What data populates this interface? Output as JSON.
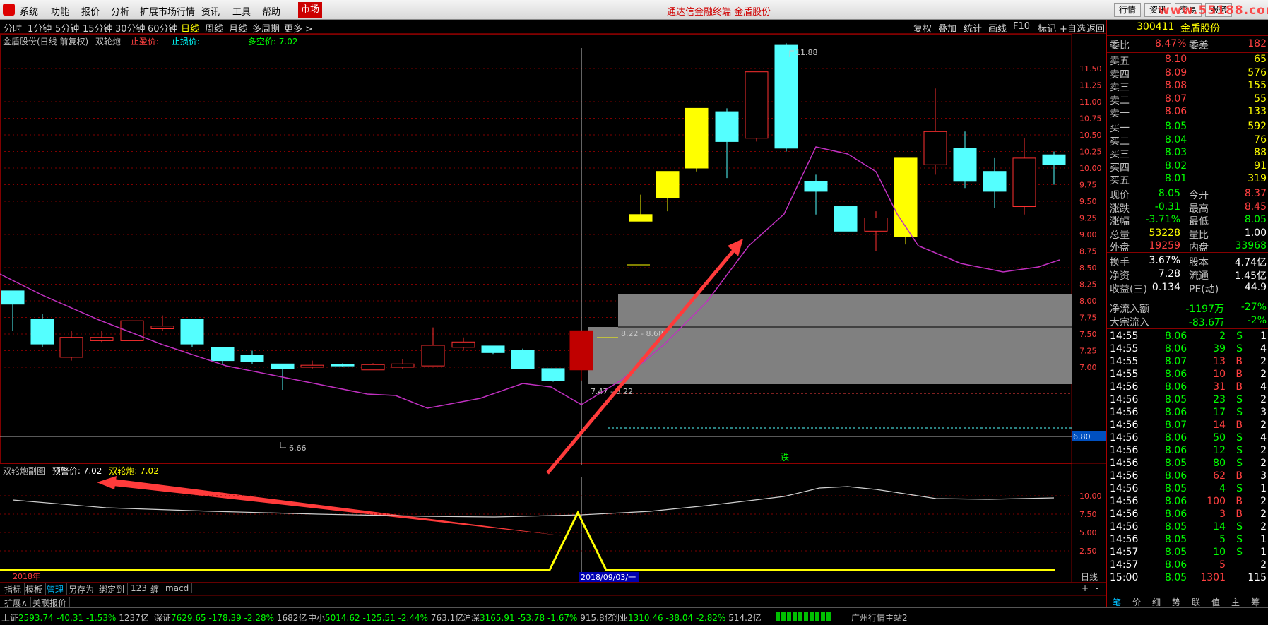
{
  "menu": [
    "系统",
    "功能",
    "报价",
    "分析",
    "扩展市场行情",
    "资讯",
    "工具",
    "帮助"
  ],
  "market_label": "市场",
  "window_title": "通达信金融终端 金盾股份",
  "top_right": [
    "行情",
    "资讯",
    "交易",
    "服务"
  ],
  "watermark": "www.55188.com",
  "periods": [
    "分时",
    "1分钟",
    "5分钟",
    "15分钟",
    "30分钟",
    "60分钟",
    "日线",
    "周线",
    "月线",
    "多周期",
    "更多 >"
  ],
  "active_period": "日线",
  "right_tools": [
    "复权",
    "叠加",
    "统计",
    "画线",
    "F10",
    "标记",
    "+自选",
    "返回"
  ],
  "chart_title": {
    "name": "金盾股份(日线 前复权)",
    "indicator": "双轮炮",
    "stop_profit": "止盈价: -",
    "stop_loss": "止损价: -",
    "duokong": "多空价: 7.02"
  },
  "sub_title": {
    "name": "双轮炮副图",
    "warn": "预警价: 7.02",
    "sig": "双轮炮: 7.02"
  },
  "price_axis": [
    "11.50",
    "11.25",
    "11.00",
    "10.75",
    "10.50",
    "10.25",
    "10.00",
    "9.75",
    "9.50",
    "9.25",
    "9.00",
    "8.75",
    "8.50",
    "8.25",
    "8.00",
    "7.75",
    "7.50",
    "7.25",
    "7.00"
  ],
  "current_price_tag": "6.80",
  "annotations": {
    "high": "11.88",
    "low": "6.66",
    "range1": "8.22 - 8.68",
    "range2": "7.47 - 8.22",
    "fall": "跌",
    "year": "2018年",
    "date": "2018/09/03/一",
    "daily": "日线"
  },
  "sub_axis": [
    "10.00",
    "7.50",
    "5.00",
    "2.50"
  ],
  "tabs": [
    "指标",
    "模板",
    "管理",
    "另存为",
    "绑定到",
    "123",
    "缠",
    "macd"
  ],
  "tabs_row2": [
    "扩展∧",
    "关联报价"
  ],
  "right_panel": {
    "code": "300411",
    "name": "金盾股份",
    "weibi_label": "委比",
    "weibi": "8.47%",
    "weicha_label": "委差",
    "weicha": "182",
    "asks": [
      {
        "label": "卖五",
        "price": "8.10",
        "vol": "65"
      },
      {
        "label": "卖四",
        "price": "8.09",
        "vol": "576"
      },
      {
        "label": "卖三",
        "price": "8.08",
        "vol": "155"
      },
      {
        "label": "卖二",
        "price": "8.07",
        "vol": "55"
      },
      {
        "label": "卖一",
        "price": "8.06",
        "vol": "133"
      }
    ],
    "bids": [
      {
        "label": "买一",
        "price": "8.05",
        "vol": "592"
      },
      {
        "label": "买二",
        "price": "8.04",
        "vol": "76"
      },
      {
        "label": "买三",
        "price": "8.03",
        "vol": "88"
      },
      {
        "label": "买四",
        "price": "8.02",
        "vol": "91"
      },
      {
        "label": "买五",
        "price": "8.01",
        "vol": "319"
      }
    ],
    "stats": [
      {
        "l1": "现价",
        "v1": "8.05",
        "c1": "down",
        "l2": "今开",
        "v2": "8.37",
        "c2": "up"
      },
      {
        "l1": "涨跌",
        "v1": "-0.31",
        "c1": "down",
        "l2": "最高",
        "v2": "8.45",
        "c2": "up"
      },
      {
        "l1": "涨幅",
        "v1": "-3.71%",
        "c1": "down",
        "l2": "最低",
        "v2": "8.05",
        "c2": "down"
      },
      {
        "l1": "总量",
        "v1": "53228",
        "c1": "yel",
        "l2": "量比",
        "v2": "1.00",
        "c2": "white"
      },
      {
        "l1": "外盘",
        "v1": "19259",
        "c1": "up",
        "l2": "内盘",
        "v2": "33968",
        "c2": "down"
      }
    ],
    "stats2": [
      {
        "l1": "换手",
        "v1": "3.67%",
        "l2": "股本",
        "v2": "4.74亿"
      },
      {
        "l1": "净资",
        "v1": "7.28",
        "l2": "流通",
        "v2": "1.45亿"
      },
      {
        "l1": "收益(三)",
        "v1": "0.134",
        "l2": "PE(动)",
        "v2": "44.9"
      }
    ],
    "flows": [
      {
        "label": "净流入额",
        "v1": "-1197万",
        "v2": "-27%"
      },
      {
        "label": "大宗流入",
        "v1": "-83.6万",
        "v2": "-2%"
      }
    ],
    "ticks": [
      {
        "t": "14:55",
        "p": "8.06",
        "v": "2",
        "s": "S",
        "n": "1"
      },
      {
        "t": "14:55",
        "p": "8.06",
        "v": "39",
        "s": "S",
        "n": "4"
      },
      {
        "t": "14:55",
        "p": "8.07",
        "v": "13",
        "s": "B",
        "n": "2"
      },
      {
        "t": "14:55",
        "p": "8.06",
        "v": "10",
        "s": "B",
        "n": "2"
      },
      {
        "t": "14:56",
        "p": "8.06",
        "v": "31",
        "s": "B",
        "n": "4"
      },
      {
        "t": "14:56",
        "p": "8.05",
        "v": "23",
        "s": "S",
        "n": "2"
      },
      {
        "t": "14:56",
        "p": "8.06",
        "v": "17",
        "s": "S",
        "n": "3"
      },
      {
        "t": "14:56",
        "p": "8.07",
        "v": "14",
        "s": "B",
        "n": "2"
      },
      {
        "t": "14:56",
        "p": "8.06",
        "v": "50",
        "s": "S",
        "n": "4"
      },
      {
        "t": "14:56",
        "p": "8.06",
        "v": "12",
        "s": "S",
        "n": "2"
      },
      {
        "t": "14:56",
        "p": "8.05",
        "v": "80",
        "s": "S",
        "n": "2"
      },
      {
        "t": "14:56",
        "p": "8.06",
        "v": "62",
        "s": "B",
        "n": "3"
      },
      {
        "t": "14:56",
        "p": "8.05",
        "v": "4",
        "s": "S",
        "n": "1"
      },
      {
        "t": "14:56",
        "p": "8.06",
        "v": "100",
        "s": "B",
        "n": "2"
      },
      {
        "t": "14:56",
        "p": "8.06",
        "v": "3",
        "s": "B",
        "n": "2"
      },
      {
        "t": "14:56",
        "p": "8.05",
        "v": "14",
        "s": "S",
        "n": "2"
      },
      {
        "t": "14:56",
        "p": "8.05",
        "v": "5",
        "s": "S",
        "n": "1"
      },
      {
        "t": "14:57",
        "p": "8.05",
        "v": "10",
        "s": "S",
        "n": "1"
      },
      {
        "t": "14:57",
        "p": "8.06",
        "v": "5",
        "s": "",
        "n": "2"
      },
      {
        "t": "15:00",
        "p": "8.05",
        "v": "1301",
        "s": "",
        "n": "115"
      }
    ],
    "bottom_tabs": [
      "笔",
      "价",
      "细",
      "势",
      "联",
      "值",
      "主",
      "筹"
    ]
  },
  "status": [
    {
      "name": "上证",
      "val": "2593.74",
      "chg": "-40.31",
      "pct": "-1.53%",
      "amt": "1237亿"
    },
    {
      "name": "深证",
      "val": "7629.65",
      "chg": "-178.39",
      "pct": "-2.28%",
      "amt": "1682亿"
    },
    {
      "name": "中小",
      "val": "5014.62",
      "chg": "-125.51",
      "pct": "-2.44%",
      "amt": "763.1亿"
    },
    {
      "name": "沪深",
      "val": "3165.91",
      "chg": "-53.78",
      "pct": "-1.67%",
      "amt": "915.8亿"
    },
    {
      "name": "创业",
      "val": "1310.46",
      "chg": "-38.04",
      "pct": "-2.82%",
      "amt": "514.2亿"
    }
  ],
  "status_station": "广州行情主站2",
  "colors": {
    "bull": "#ff3030",
    "bear": "#54ffff",
    "yellow": "#ffff00",
    "ma": "#c030c0",
    "grid": "#800000"
  }
}
